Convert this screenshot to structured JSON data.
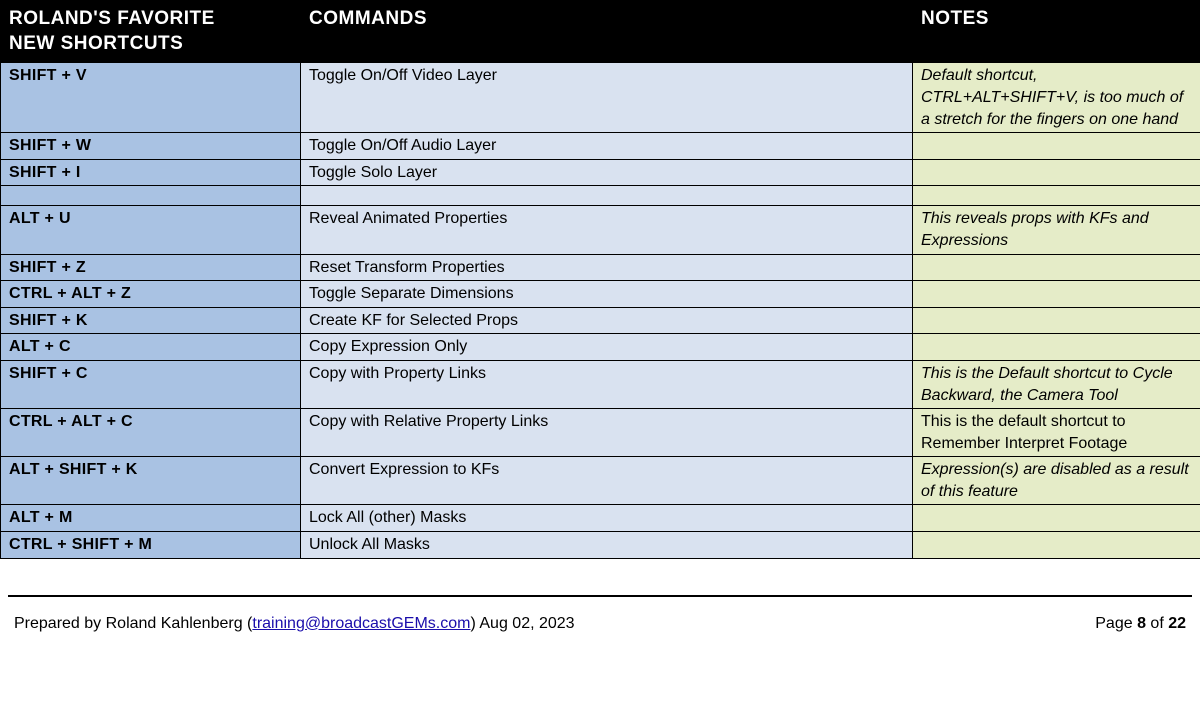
{
  "headers": {
    "shortcuts_title_line1": "ROLAND'S FAVORITE",
    "shortcuts_title_line2": "NEW SHORTCUTS",
    "commands": "COMMANDS",
    "notes": "NOTES"
  },
  "rows": [
    {
      "shortcut": "SHIFT + V",
      "command": "Toggle On/Off Video Layer",
      "note": "Default shortcut, CTRL+ALT+SHIFT+V, is too much of a stretch for the fingers on one hand",
      "italic": true
    },
    {
      "shortcut": "SHIFT + W",
      "command": "Toggle On/Off Audio Layer",
      "note": "",
      "italic": true
    },
    {
      "shortcut": "SHIFT + I",
      "command": "Toggle Solo Layer",
      "note": "",
      "italic": true
    },
    {
      "spacer": true
    },
    {
      "shortcut": "ALT + U",
      "command": "Reveal Animated Properties",
      "note": "This reveals props with KFs and Expressions",
      "italic": true
    },
    {
      "shortcut": "SHIFT + Z",
      "command": "Reset Transform Properties",
      "note": "",
      "italic": true
    },
    {
      "shortcut": "CTRL + ALT + Z",
      "command": "Toggle Separate Dimensions",
      "note": "",
      "italic": true
    },
    {
      "shortcut": "SHIFT + K",
      "command": "Create KF for Selected Props",
      "note": "",
      "italic": true
    },
    {
      "shortcut": "ALT + C",
      "command": "Copy Expression Only",
      "note": "",
      "italic": true
    },
    {
      "shortcut": "SHIFT + C",
      "command": "Copy with Property Links",
      "note": "This is the Default shortcut to Cycle Backward, the Camera Tool",
      "italic": true
    },
    {
      "shortcut": "CTRL + ALT + C",
      "command": "Copy with Relative Property Links",
      "note": "This is the default shortcut to Remember Interpret Footage",
      "italic": false
    },
    {
      "shortcut": "ALT + SHIFT + K",
      "command": "Convert Expression to KFs",
      "note": "Expression(s) are disabled as a result of this feature",
      "italic": true
    },
    {
      "shortcut": "ALT + M",
      "command": "Lock All (other) Masks",
      "note": "",
      "italic": true
    },
    {
      "shortcut": "CTRL + SHIFT + M",
      "command": "Unlock All Masks",
      "note": "",
      "italic": true
    }
  ],
  "footer": {
    "prepared_prefix": "Prepared by Roland Kahlenberg (",
    "email": "training@broadcastGEMs.com",
    "prepared_suffix": ") Aug 02, 2023",
    "page_label": "Page ",
    "page_current": "8",
    "page_sep": " of ",
    "page_total": "22"
  }
}
